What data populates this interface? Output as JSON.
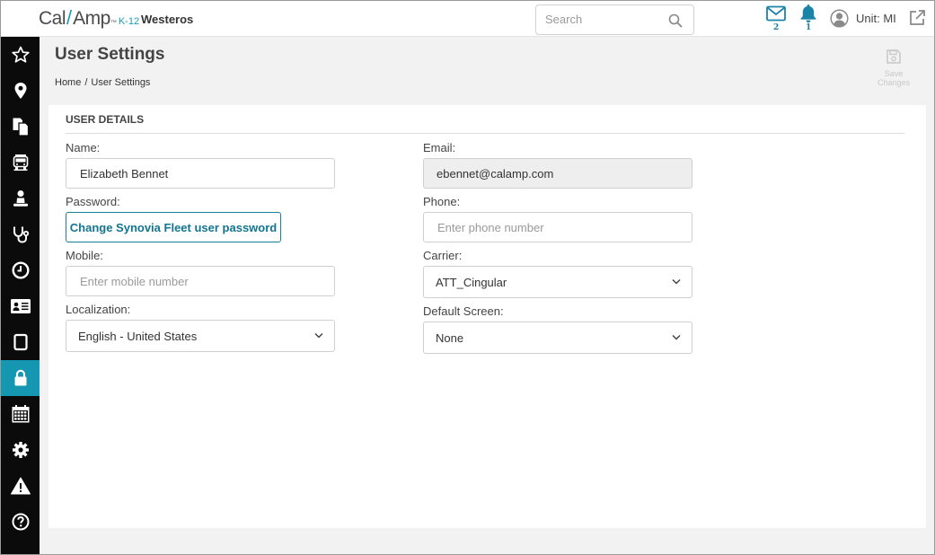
{
  "header": {
    "logo_main_left": "Cal",
    "logo_main_right": "Amp",
    "logo_tm": "™",
    "logo_suffix": "K-12",
    "org_name": "Westeros",
    "search_placeholder": "Search",
    "messages_count": "2",
    "alerts_count": "1",
    "unit_label": "Unit: MI"
  },
  "sidebar": {
    "items": [
      {
        "name": "favorites",
        "icon": "star-icon"
      },
      {
        "name": "map",
        "icon": "map-pin-icon"
      },
      {
        "name": "documents",
        "icon": "documents-icon"
      },
      {
        "name": "vehicles",
        "icon": "bus-icon"
      },
      {
        "name": "drivers",
        "icon": "person-icon"
      },
      {
        "name": "diagnostics",
        "icon": "stethoscope-icon"
      },
      {
        "name": "history",
        "icon": "clock-icon"
      },
      {
        "name": "id-cards",
        "icon": "id-card-icon"
      },
      {
        "name": "tablets",
        "icon": "tablet-icon"
      },
      {
        "name": "security",
        "icon": "lock-icon",
        "active": true
      },
      {
        "name": "calendar",
        "icon": "calendar-icon"
      },
      {
        "name": "settings",
        "icon": "gear-icon"
      },
      {
        "name": "alerts",
        "icon": "warning-icon"
      },
      {
        "name": "help",
        "icon": "help-icon"
      }
    ],
    "active_color": "#1596b1"
  },
  "page": {
    "title": "User Settings",
    "breadcrumb": {
      "home": "Home",
      "separator": "/",
      "current": "User Settings"
    },
    "save_label_line1": "Save",
    "save_label_line2": "Changes"
  },
  "user_details": {
    "section_title": "USER DETAILS",
    "name": {
      "label": "Name:",
      "value": "Elizabeth Bennet"
    },
    "email": {
      "label": "Email:",
      "value": "ebennet@calamp.com"
    },
    "password": {
      "label": "Password:",
      "button": "Change Synovia Fleet user password"
    },
    "phone": {
      "label": "Phone:",
      "placeholder": "Enter phone number"
    },
    "mobile": {
      "label": "Mobile:",
      "placeholder": "Enter mobile number"
    },
    "carrier": {
      "label": "Carrier:",
      "selected": "ATT_Cingular"
    },
    "localization": {
      "label": "Localization:",
      "selected": "English - United States"
    },
    "default_screen": {
      "label": "Default Screen:",
      "selected": "None"
    }
  },
  "colors": {
    "accent": "#1596b1",
    "sidebar_bg": "#0b0b0b",
    "button_text": "#137490"
  }
}
